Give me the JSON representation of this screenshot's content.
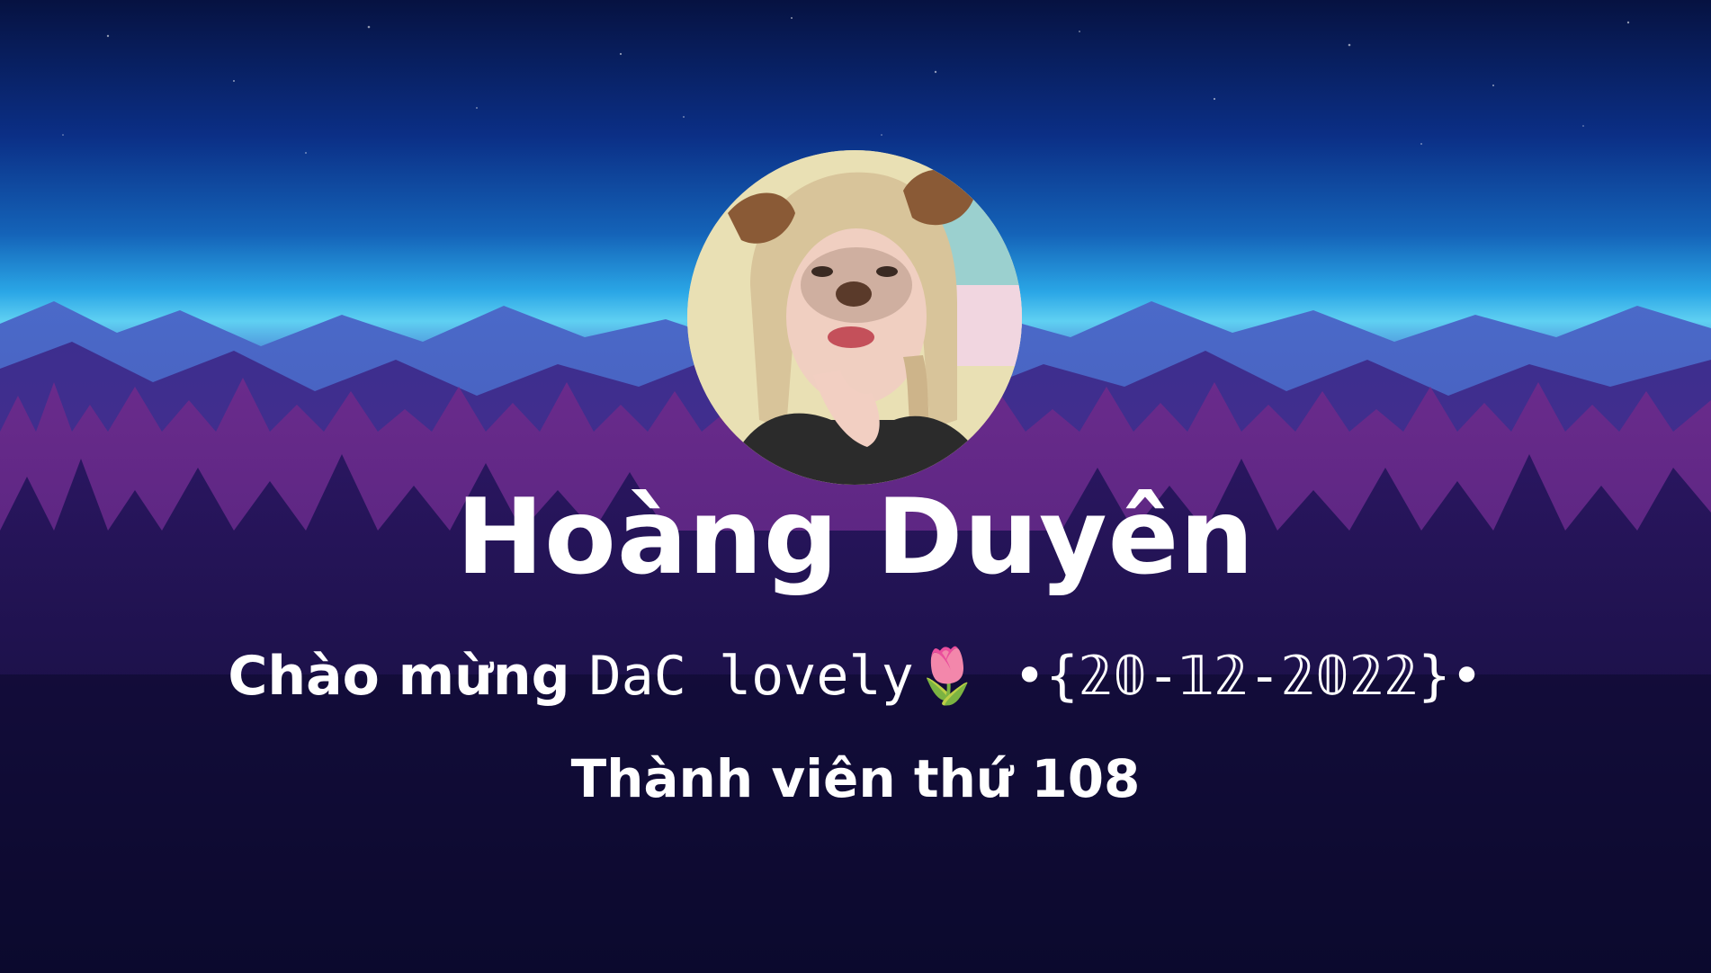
{
  "banner": {
    "name": "Hoàng Duyên",
    "welcome_prefix": "Chào mừng ",
    "welcome_nickname": "DaC lovely🌷",
    "welcome_date": " •{𝟚𝟘-𝟙𝟚-𝟚𝟘𝟚𝟚}•",
    "member_text": "Thành viên thứ 108"
  },
  "colors": {
    "text": "#ffffff",
    "sky_top": "#061241",
    "horizon": "#5fd0f2",
    "forest": "#3a2380",
    "ground": "#0a0a2c"
  },
  "icons": {
    "avatar": "user-avatar-photo"
  }
}
